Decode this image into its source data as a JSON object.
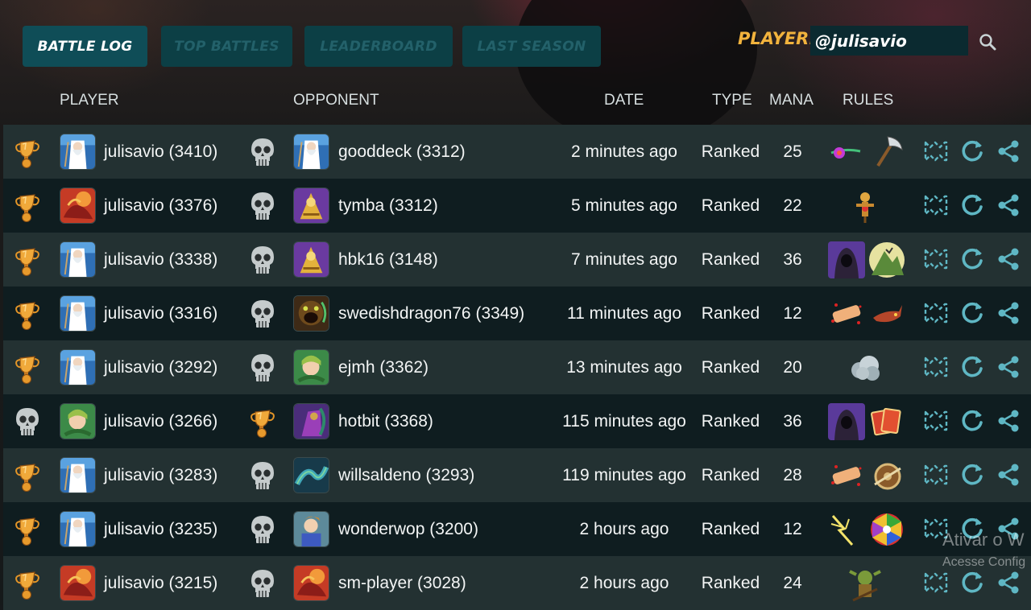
{
  "tabs": [
    {
      "label": "BATTLE LOG",
      "active": true
    },
    {
      "label": "TOP BATTLES",
      "active": false
    },
    {
      "label": "LEADERBOARD",
      "active": false
    },
    {
      "label": "LAST SEASON",
      "active": false
    }
  ],
  "player": {
    "label": "PLAYER:",
    "value": "@julisavio",
    "search_icon": "search-icon"
  },
  "columns": {
    "player": "PLAYER",
    "opponent": "OPPONENT",
    "date": "DATE",
    "type": "TYPE",
    "mana": "MANA",
    "rules": "RULES"
  },
  "rows": [
    {
      "player_result": "win",
      "player": "julisavio (3410)",
      "player_avatar": "wizard",
      "opponent_result": "loss",
      "opponent": "gooddeck (3312)",
      "opponent_avatar": "wizard",
      "date": "2 minutes ago",
      "type": "Ranked",
      "mana": "25",
      "rules": [
        "comet-rule-icon",
        "axe-rule-icon"
      ]
    },
    {
      "player_result": "win",
      "player": "julisavio (3376)",
      "player_avatar": "dragon",
      "opponent_result": "loss",
      "opponent": "tymba (3312)",
      "opponent_avatar": "golden-warrior",
      "date": "5 minutes ago",
      "type": "Ranked",
      "mana": "22",
      "rules": [
        "target-dummy-rule-icon"
      ]
    },
    {
      "player_result": "win",
      "player": "julisavio (3338)",
      "player_avatar": "wizard",
      "opponent_result": "loss",
      "opponent": "hbk16 (3148)",
      "opponent_avatar": "golden-warrior",
      "date": "7 minutes ago",
      "type": "Ranked",
      "mana": "36",
      "rules": [
        "hooded-figure-rule-icon",
        "mountain-rule-icon"
      ]
    },
    {
      "player_result": "win",
      "player": "julisavio (3316)",
      "player_avatar": "wizard",
      "opponent_result": "loss",
      "opponent": "swedishdragon76 (3349)",
      "opponent_avatar": "monster",
      "date": "11 minutes ago",
      "type": "Ranked",
      "mana": "12",
      "rules": [
        "bandage-rule-icon",
        "horned-beast-rule-icon"
      ]
    },
    {
      "player_result": "win",
      "player": "julisavio (3292)",
      "player_avatar": "wizard",
      "opponent_result": "loss",
      "opponent": "ejmh (3362)",
      "opponent_avatar": "elf",
      "date": "13 minutes ago",
      "type": "Ranked",
      "mana": "20",
      "rules": [
        "cloud-rule-icon"
      ]
    },
    {
      "player_result": "loss",
      "player": "julisavio (3266)",
      "player_avatar": "elf",
      "opponent_result": "win",
      "opponent": "hotbit (3368)",
      "opponent_avatar": "purple-warrior",
      "date": "115 minutes ago",
      "type": "Ranked",
      "mana": "36",
      "rules": [
        "hooded-figure-rule-icon",
        "cards-rule-icon"
      ]
    },
    {
      "player_result": "win",
      "player": "julisavio (3283)",
      "player_avatar": "wizard",
      "opponent_result": "loss",
      "opponent": "willsaldeno (3293)",
      "opponent_avatar": "serpent",
      "date": "119 minutes ago",
      "type": "Ranked",
      "mana": "28",
      "rules": [
        "bandage-rule-icon",
        "shield-rule-icon"
      ]
    },
    {
      "player_result": "win",
      "player": "julisavio (3235)",
      "player_avatar": "wizard",
      "opponent_result": "loss",
      "opponent": "wonderwop (3200)",
      "opponent_avatar": "knight",
      "date": "2 hours ago",
      "type": "Ranked",
      "mana": "12",
      "rules": [
        "spark-rule-icon",
        "rainbow-rule-icon"
      ]
    },
    {
      "player_result": "win",
      "player": "julisavio (3215)",
      "player_avatar": "dragon",
      "opponent_result": "loss",
      "opponent": "sm-player (3028)",
      "opponent_avatar": "dragon",
      "date": "2 hours ago",
      "type": "Ranked",
      "mana": "24",
      "rules": [
        "goblin-rule-icon"
      ]
    }
  ],
  "actions": [
    "view-battle-icon",
    "replay-icon",
    "share-icon"
  ],
  "watermark": {
    "line1": "Ativar o W",
    "line2": "Acesse Config"
  },
  "colors": {
    "accent_teal": "#0f4d57",
    "action_icon": "#5fb7c4",
    "gold": "#f2b33d",
    "row_even": "#233132",
    "row_odd": "#0f1d20"
  }
}
